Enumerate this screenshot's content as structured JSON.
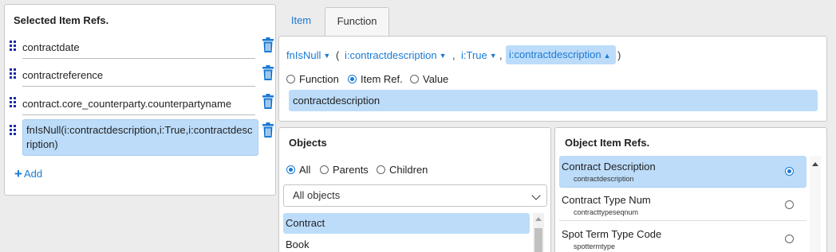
{
  "left": {
    "title": "Selected Item Refs.",
    "items": [
      {
        "label": "contractdate"
      },
      {
        "label": "contractreference"
      },
      {
        "label": "contract.core_counterparty.counterpartyname"
      },
      {
        "label": "fnIsNull(i:contractdescription,i:True,i:contractdescription)"
      }
    ],
    "add_label": "Add"
  },
  "tabs": [
    {
      "label": "Item",
      "active": false
    },
    {
      "label": "Function",
      "active": true
    }
  ],
  "function": {
    "name": "fnIsNull",
    "open_paren": "(",
    "arg1": "i:contractdescription",
    "comma": ",",
    "arg2": "i:True",
    "arg3": "i:contractdescription",
    "close_paren": ")",
    "mode_options": [
      "Function",
      "Item Ref.",
      "Value"
    ],
    "mode_selected": "Item Ref.",
    "value": "contractdescription"
  },
  "objects": {
    "title": "Objects",
    "filter_options": [
      "All",
      "Parents",
      "Children"
    ],
    "filter_selected": "All",
    "select_value": "All objects",
    "items": [
      "Contract",
      "Book"
    ]
  },
  "object_item_refs": {
    "title": "Object Item Refs.",
    "items": [
      {
        "label": "Contract Description",
        "sub": "contractdescription",
        "selected": true
      },
      {
        "label": "Contract Type Num",
        "sub": "contracttypeseqnum",
        "selected": false
      },
      {
        "label": "Spot Term Type Code",
        "sub": "spottermtype",
        "selected": false
      }
    ]
  },
  "colors": {
    "accent": "#1a7ad4",
    "selection": "#bcdcfa",
    "trash": "#1a7ad4"
  }
}
